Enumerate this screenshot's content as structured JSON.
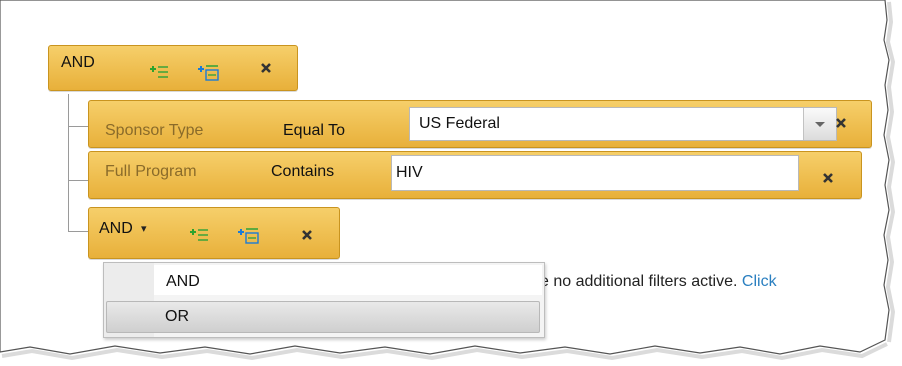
{
  "root_group": {
    "operator": "AND",
    "add_condition_icon": "add-condition-icon",
    "add_group_icon": "add-group-icon",
    "remove_icon": "close-icon"
  },
  "conditions": [
    {
      "field": "Sponsor Type",
      "operator": "Equal To",
      "value": "US Federal",
      "input_type": "dropdown"
    },
    {
      "field": "Full Program",
      "operator": "Contains",
      "value": "HIV",
      "input_type": "text"
    }
  ],
  "sub_group": {
    "operator": "AND",
    "caret": "▾"
  },
  "operator_menu": {
    "options": [
      "AND",
      "OR"
    ],
    "highlighted": "OR"
  },
  "status": {
    "text": "e no additional filters active.",
    "link": "Click"
  },
  "colors": {
    "chip": "#eebd4c",
    "chip_border": "#c9941f",
    "link": "#2a7fc0",
    "field_label": "#8a6b2a"
  }
}
